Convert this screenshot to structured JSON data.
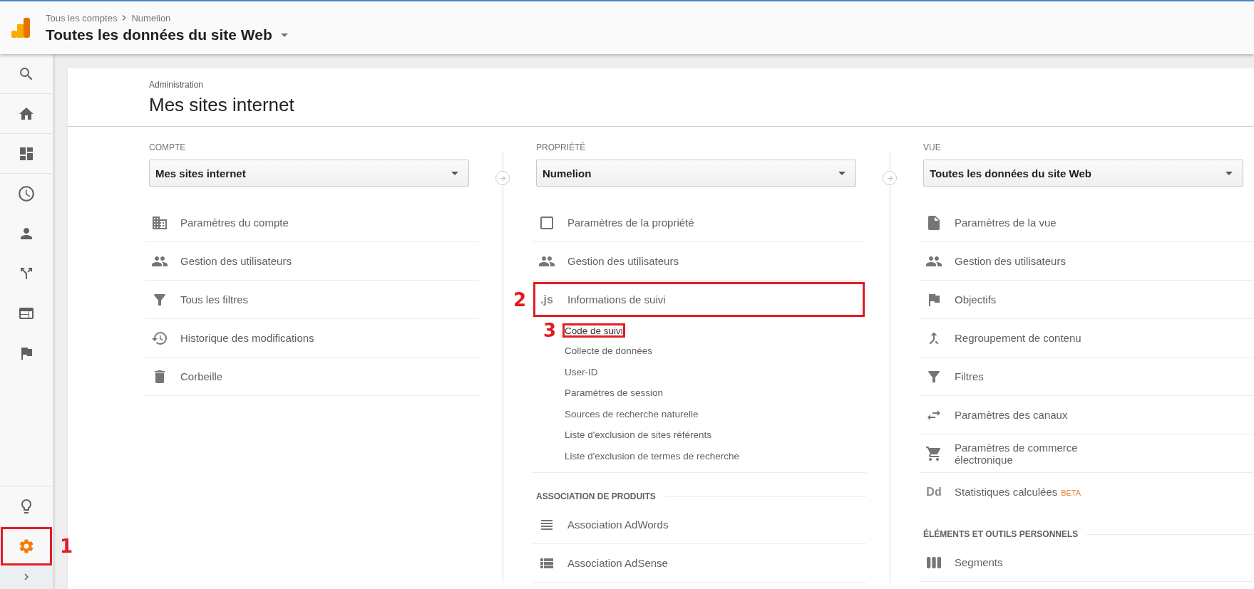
{
  "header": {
    "breadcrumb": [
      "Tous les comptes",
      "Numelion"
    ],
    "title": "Toutes les données du site Web"
  },
  "sidebar": {
    "top_items": [
      {
        "selected": false
      },
      {
        "selected": false
      },
      {
        "selected": false
      },
      {
        "selected": false
      },
      {
        "selected": false
      },
      {
        "selected": false
      },
      {
        "selected": false
      },
      {
        "selected": false
      }
    ],
    "bottom_items": [
      {
        "selected": false
      },
      {
        "selected": true,
        "annotation": "1"
      }
    ]
  },
  "page": {
    "eyebrow": "Administration",
    "title": "Mes sites internet"
  },
  "columns": [
    {
      "label": "COMPTE",
      "dropdown": "Mes sites internet",
      "items": [
        {
          "label": "Paramètres du compte"
        },
        {
          "label": "Gestion des utilisateurs"
        },
        {
          "label": "Tous les filtres"
        },
        {
          "label": "Historique des modifications"
        },
        {
          "label": "Corbeille"
        }
      ]
    },
    {
      "label": "PROPRIÉTÉ",
      "dropdown": "Numelion",
      "items": [
        {
          "label": "Paramètres de la propriété"
        },
        {
          "label": "Gestion des utilisateurs"
        },
        {
          "label": "Informations de suivi",
          "glyph": ".js",
          "annotation": "2",
          "children": [
            {
              "label": "Code de suivi",
              "annotation": "3"
            },
            {
              "label": "Collecte de données"
            },
            {
              "label": "User-ID"
            },
            {
              "label": "Paramètres de session"
            },
            {
              "label": "Sources de recherche naturelle"
            },
            {
              "label": "Liste d'exclusion de sites référents"
            },
            {
              "label": "Liste d'exclusion de termes de recherche"
            }
          ]
        }
      ],
      "sections": [
        {
          "title": "ASSOCIATION DE PRODUITS",
          "items": [
            {
              "label": "Association AdWords"
            },
            {
              "label": "Association AdSense"
            }
          ]
        }
      ]
    },
    {
      "label": "VUE",
      "dropdown": "Toutes les données du site Web",
      "items": [
        {
          "label": "Paramètres de la vue"
        },
        {
          "label": "Gestion des utilisateurs"
        },
        {
          "label": "Objectifs"
        },
        {
          "label": "Regroupement de contenu"
        },
        {
          "label": "Filtres"
        },
        {
          "label": "Paramètres des canaux"
        },
        {
          "label": "Paramètres de commerce électronique"
        },
        {
          "label": "Statistiques calculées",
          "glyph": "Dd",
          "badge": "BETA"
        }
      ],
      "sections": [
        {
          "title": "ÉLÉMENTS ET OUTILS PERSONNELS",
          "items": [
            {
              "label": "Segments"
            }
          ]
        }
      ]
    }
  ]
}
